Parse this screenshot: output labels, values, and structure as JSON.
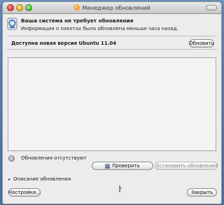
{
  "window": {
    "title": "Менеджер обновлений",
    "controls": [
      "close",
      "minimize",
      "zoom"
    ]
  },
  "status": {
    "icon": "update-manager-icon",
    "title": "Ваша система не требует обновления",
    "subtitle": "Информация о пакетах была обновлена меньше часа назад."
  },
  "upgrade": {
    "text": "Доступна новая версия Ubuntu 11.04",
    "button_label": "Обновить"
  },
  "updates": {
    "items": [],
    "status_icon": "no-updates-icon",
    "status_label": "Обновления отсутствуют"
  },
  "actions": {
    "check_label": "Проверить",
    "install_label": "Установить обновления",
    "description_label": "Описание обновления",
    "settings_label": "Настройки...",
    "close_label": "Закрыть"
  }
}
